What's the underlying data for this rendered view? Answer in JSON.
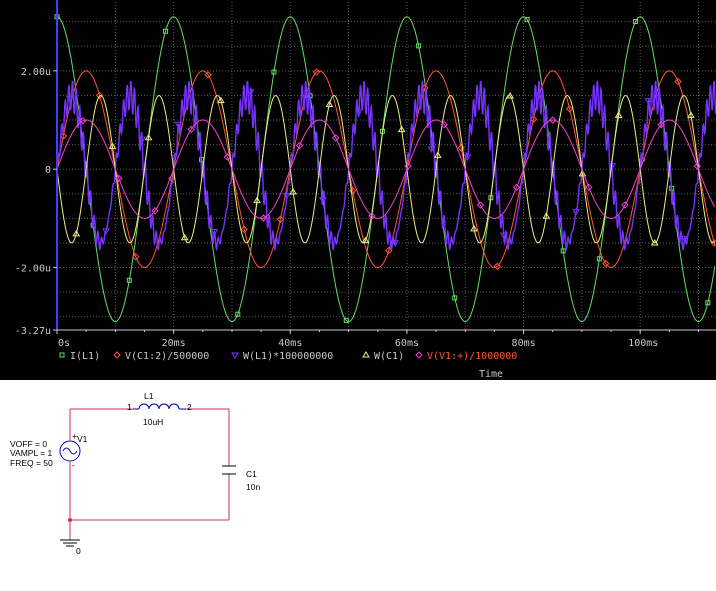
{
  "chart_data": {
    "type": "line",
    "xlabel": "Time",
    "x_range_ms": [
      0,
      113
    ],
    "y_range": [
      -3.27,
      3.4
    ],
    "grid": true,
    "x_ticks": [
      {
        "label": "0s",
        "value": 0
      },
      {
        "label": "20ms",
        "value": 20
      },
      {
        "label": "40ms",
        "value": 40
      },
      {
        "label": "60ms",
        "value": 60
      },
      {
        "label": "80ms",
        "value": 80
      },
      {
        "label": "100ms",
        "value": 100
      }
    ],
    "y_ticks": [
      {
        "label": "2.00u",
        "value": 2
      },
      {
        "label": "0",
        "value": 0
      },
      {
        "label": "-2.00u",
        "value": -2
      },
      {
        "label": "-3.27u",
        "value": -3.27
      }
    ],
    "series": [
      {
        "name": "I(L1)",
        "color": "#66dd66",
        "marker": "square",
        "frequency_hz": 50,
        "amplitude": 3.1,
        "phase_deg": 90,
        "oscillation_hz": 0,
        "oscillation_amplitude": 0
      },
      {
        "name": "V(C1:2)/500000",
        "color": "#ff5533",
        "marker": "diamond",
        "frequency_hz": 50,
        "amplitude": 2.0,
        "phase_deg": 0,
        "oscillation_hz": 0,
        "oscillation_amplitude": 0
      },
      {
        "name": "W(L1)*100000000",
        "color": "#7733ff",
        "marker": "triangle-down",
        "frequency_hz": 100,
        "amplitude": 1.5,
        "phase_deg": 0,
        "oscillation_hz": 1600,
        "oscillation_amplitude": 0.32
      },
      {
        "name": "W(C1)",
        "color": "#eeee88",
        "marker": "triangle-up",
        "frequency_hz": 100,
        "amplitude": 1.5,
        "phase_deg": 180,
        "oscillation_hz": 0,
        "oscillation_amplitude": 0
      },
      {
        "name": "V(V1:+)/1000000",
        "color": "#ee44cc",
        "marker": "diamond",
        "frequency_hz": 50,
        "amplitude": 1.0,
        "phase_deg": 0,
        "oscillation_hz": 0,
        "oscillation_amplitude": 0
      }
    ]
  },
  "schematic": {
    "inductor_name": "L1",
    "inductor_value": "10uH",
    "inductor_pin1": "1",
    "inductor_pin2": "2",
    "capacitor_name": "C1",
    "capacitor_value": "10n",
    "source_name": "V1",
    "source_voff": "VOFF = 0",
    "source_vampl": "VAMPL = 1",
    "source_freq": "FREQ = 50",
    "ground_label": "0"
  }
}
